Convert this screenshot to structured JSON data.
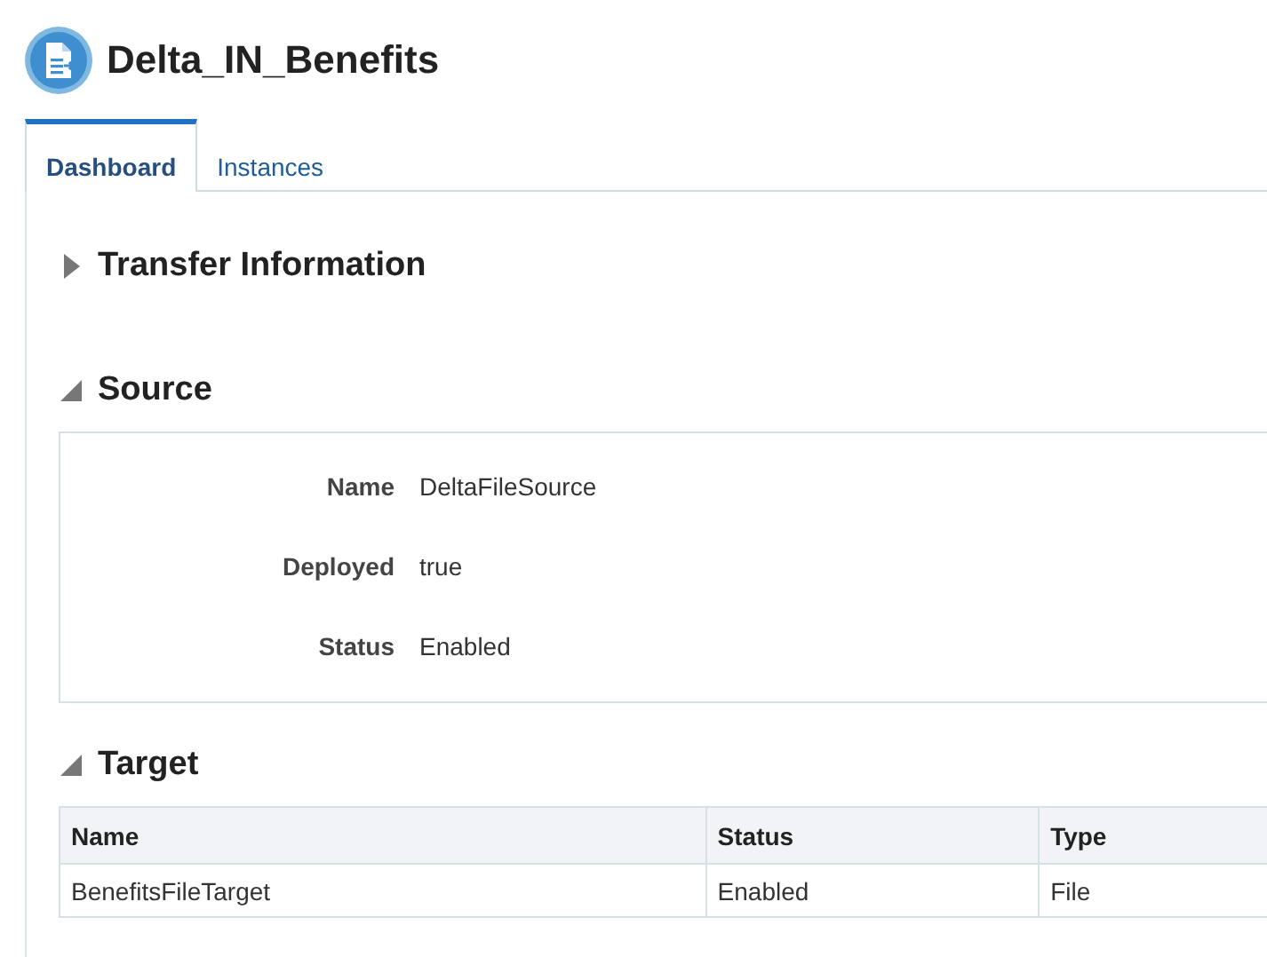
{
  "title": "Delta_IN_Benefits",
  "tabs": [
    {
      "label": "Dashboard",
      "selected": true
    },
    {
      "label": "Instances",
      "selected": false
    }
  ],
  "sections": [
    {
      "title": "Transfer Information",
      "expanded": false
    },
    {
      "title": "Source",
      "expanded": true,
      "kind": "form",
      "fields": [
        {
          "label": "Name",
          "value": "DeltaFileSource"
        },
        {
          "label": "Deployed",
          "value": "true"
        },
        {
          "label": "Status",
          "value": "Enabled"
        }
      ]
    },
    {
      "title": "Target",
      "expanded": true,
      "kind": "table",
      "columns": [
        "Name",
        "Status",
        "Type"
      ],
      "rows": [
        [
          "BenefitsFileTarget",
          "Enabled",
          "File"
        ]
      ]
    }
  ]
}
